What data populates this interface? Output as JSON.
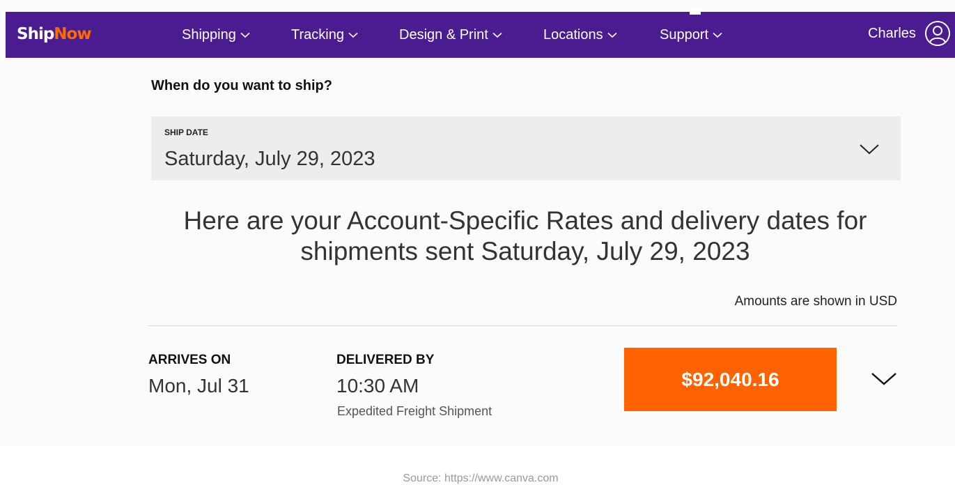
{
  "brand": {
    "logo_part1": "Ship",
    "logo_part2": "Now",
    "nav_color": "#4b1c8f",
    "accent_color": "#ff6200"
  },
  "nav": {
    "items": [
      {
        "label": "Shipping"
      },
      {
        "label": "Tracking"
      },
      {
        "label": "Design & Print"
      },
      {
        "label": "Locations"
      },
      {
        "label": "Support"
      }
    ],
    "user_name": "Charles",
    "user_icon": "user-circle-icon"
  },
  "ship_date": {
    "question": "When do you want to ship?",
    "label": "SHIP DATE",
    "value": "Saturday, July 29, 2023"
  },
  "rates": {
    "headline_line1": "Here are your Account-Specific Rates and delivery dates for",
    "headline_line2": "shipments sent Saturday, July 29, 2023",
    "currency_note": "Amounts are shown in USD"
  },
  "result": {
    "arrives_label": "ARRIVES ON",
    "arrives_value": "Mon, Jul 31",
    "delivered_label": "DELIVERED BY",
    "delivered_value": "10:30 AM",
    "service": "Expedited Freight Shipment",
    "price": "$92,040.16"
  },
  "footer": {
    "source": "Source: https://www.canva.com"
  }
}
